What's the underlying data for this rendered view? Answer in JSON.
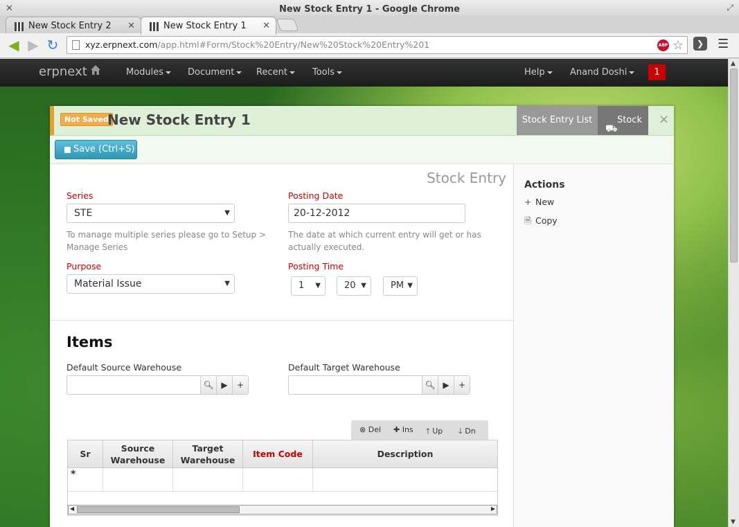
{
  "window": {
    "title": "New Stock Entry 1 - Google Chrome"
  },
  "tabs": [
    {
      "label": "New Stock Entry 2"
    },
    {
      "label": "New Stock Entry 1"
    }
  ],
  "address_bar": {
    "host": "xyz.erpnext.com",
    "path": "/app.html#Form/Stock%20Entry/New%20Stock%20Entry%201"
  },
  "navbar": {
    "brand": "erpnext",
    "menus": [
      "Modules",
      "Document",
      "Recent",
      "Tools"
    ],
    "help": "Help",
    "user": "Anand Doshi",
    "notifications": "1"
  },
  "form": {
    "status_badge": "Not Saved",
    "title": "New Stock Entry 1",
    "list_button": "Stock Entry List",
    "module_button": "Stock",
    "save_button": "Save (Ctrl+S)",
    "doctype": "Stock Entry",
    "series": {
      "label": "Series",
      "value": "STE",
      "help": "To manage multiple series please go to Setup > Manage Series"
    },
    "posting_date": {
      "label": "Posting Date",
      "value": "20-12-2012",
      "help": "The date at which current entry will get or has actually executed."
    },
    "purpose": {
      "label": "Purpose",
      "value": "Material Issue"
    },
    "posting_time": {
      "label": "Posting Time",
      "hour": "1",
      "minute": "20",
      "ampm": "PM"
    },
    "items_section": "Items",
    "default_source": {
      "label": "Default Source Warehouse",
      "value": ""
    },
    "default_target": {
      "label": "Default Target Warehouse",
      "value": ""
    },
    "grid_buttons": [
      "Del",
      "Ins",
      "Up",
      "Dn"
    ],
    "grid_columns": [
      "Sr",
      "Source Warehouse",
      "Target Warehouse",
      "Item Code",
      "Description"
    ],
    "new_row_marker": "*"
  },
  "sidebar": {
    "title": "Actions",
    "items": [
      {
        "label": "New"
      },
      {
        "label": "Copy"
      }
    ]
  },
  "colors": {
    "required_label": "#cc0000",
    "header_bg": "#dff0d8",
    "badge": "#f0ad4e",
    "save": "#2f96b4"
  }
}
